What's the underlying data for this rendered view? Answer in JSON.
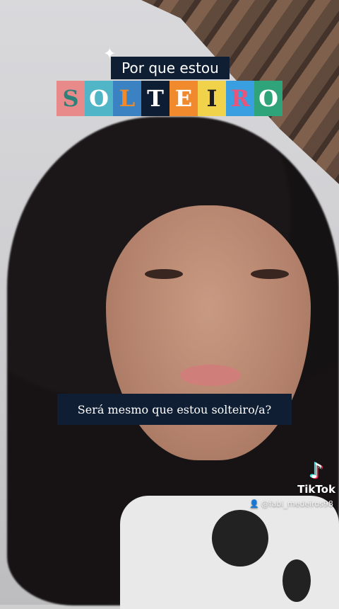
{
  "overlay": {
    "title_line": "Por que estou",
    "title_letters": [
      {
        "char": "S",
        "bg": "#e88a8a",
        "fg": "#2f7f7b"
      },
      {
        "char": "O",
        "bg": "#4fb5c7",
        "fg": "#ffffff"
      },
      {
        "char": "L",
        "bg": "#3a82c2",
        "fg": "#f08a2c"
      },
      {
        "char": "T",
        "bg": "#0d1d33",
        "fg": "#ffffff"
      },
      {
        "char": "E",
        "bg": "#f08a2c",
        "fg": "#ffffff"
      },
      {
        "char": "I",
        "bg": "#f0d34a",
        "fg": "#1d1d1d"
      },
      {
        "char": "R",
        "bg": "#3a9fe0",
        "fg": "#e8557a"
      },
      {
        "char": "O",
        "bg": "#2fa37a",
        "fg": "#ffffff"
      }
    ],
    "caption": "Será mesmo que estou solteiro/a?"
  },
  "watermark": {
    "brand": "TikTok",
    "username": "@fabi_medeiros98",
    "icon": "tiktok-note-icon",
    "user_icon": "person-icon"
  }
}
